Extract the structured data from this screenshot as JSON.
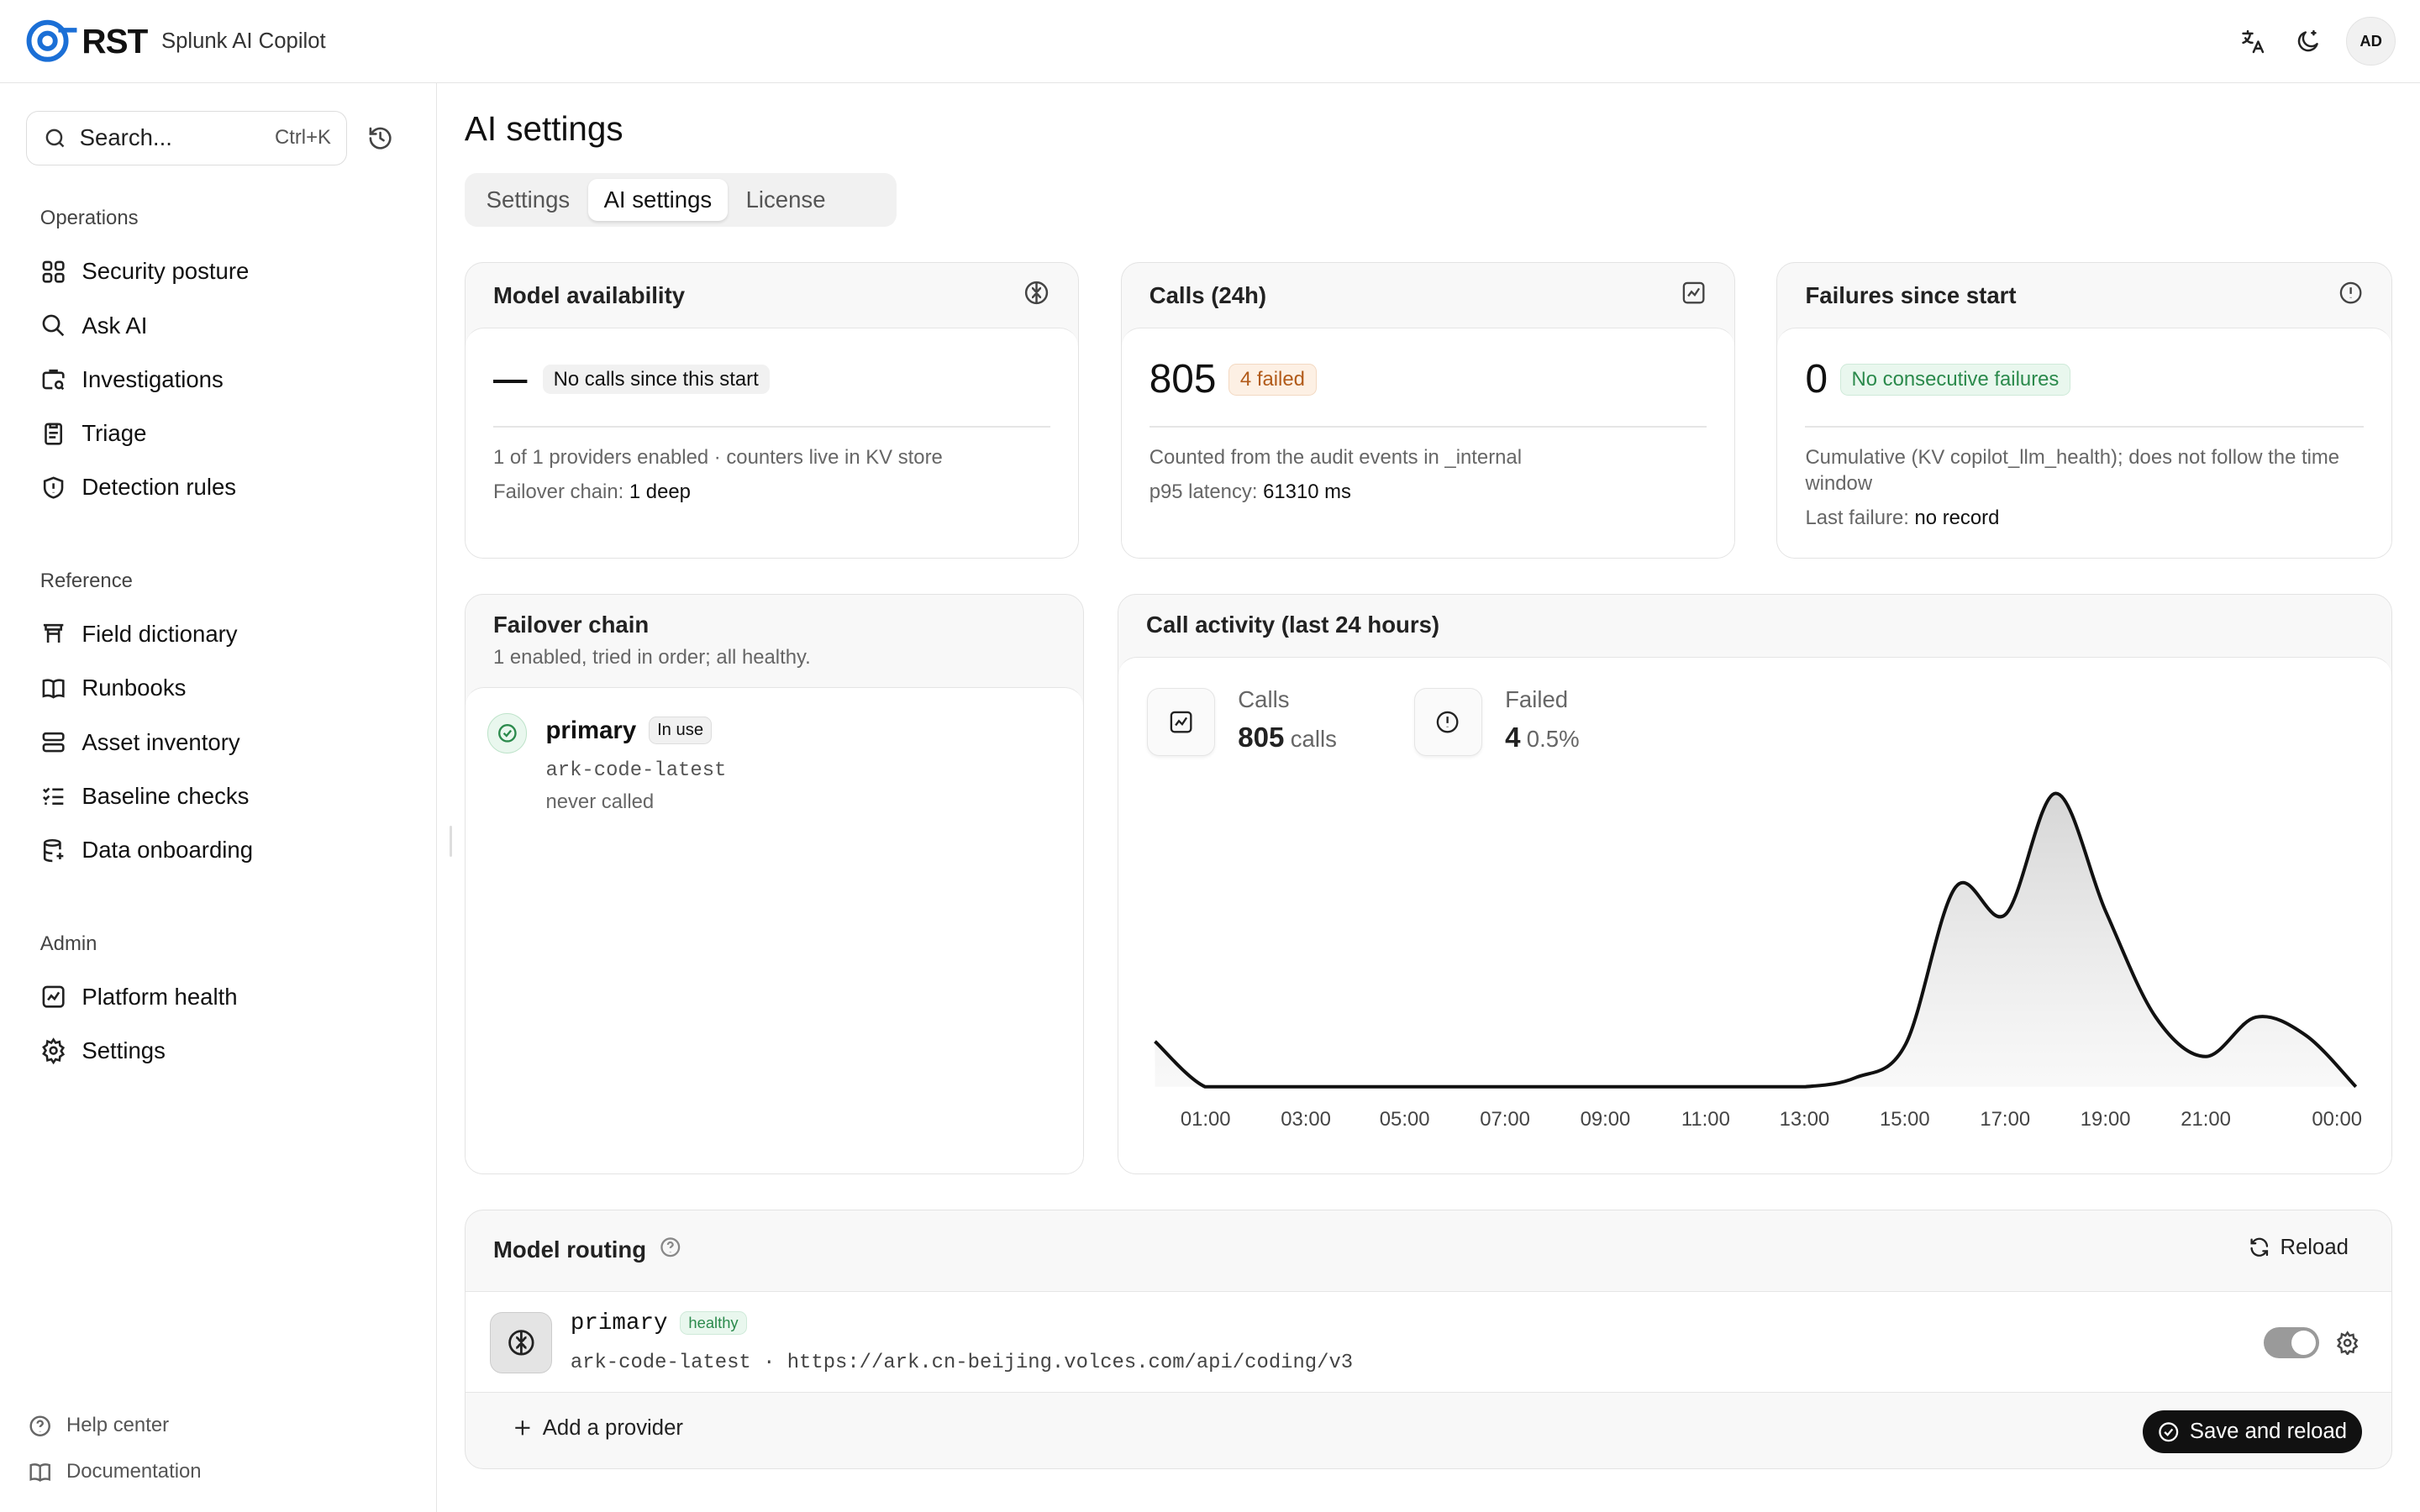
{
  "header": {
    "logo_text": "RST",
    "app_name": "Splunk AI Copilot",
    "avatar": "AD",
    "icons": [
      "translate-icon",
      "theme-toggle-icon"
    ]
  },
  "sidebar": {
    "search_placeholder": "Search...",
    "search_shortcut": "Ctrl+K",
    "sections": [
      {
        "title": "Operations",
        "items": [
          {
            "label": "Security posture",
            "icon": "grid-icon"
          },
          {
            "label": "Ask AI",
            "icon": "search-icon"
          },
          {
            "label": "Investigations",
            "icon": "briefcase-search-icon"
          },
          {
            "label": "Triage",
            "icon": "clipboard-icon"
          },
          {
            "label": "Detection rules",
            "icon": "shield-icon"
          }
        ]
      },
      {
        "title": "Reference",
        "items": [
          {
            "label": "Field dictionary",
            "icon": "table-icon"
          },
          {
            "label": "Runbooks",
            "icon": "book-icon"
          },
          {
            "label": "Asset inventory",
            "icon": "server-icon"
          },
          {
            "label": "Baseline checks",
            "icon": "checklist-icon"
          },
          {
            "label": "Data onboarding",
            "icon": "database-icon"
          }
        ]
      },
      {
        "title": "Admin",
        "items": [
          {
            "label": "Platform health",
            "icon": "chart-icon"
          },
          {
            "label": "Settings",
            "icon": "gear-icon"
          }
        ]
      }
    ],
    "footer": [
      {
        "label": "Help center",
        "icon": "help-icon"
      },
      {
        "label": "Documentation",
        "icon": "book-open-icon"
      }
    ]
  },
  "page": {
    "title": "AI settings",
    "tabs": [
      {
        "label": "Settings",
        "active": false
      },
      {
        "label": "AI settings",
        "active": true
      },
      {
        "label": "License",
        "active": false
      }
    ]
  },
  "cards": {
    "availability": {
      "title": "Model availability",
      "value": "—",
      "badge": "No calls since this start",
      "line1": "1 of 1 providers enabled · counters live in KV store",
      "line2_label": "Failover chain:",
      "line2_value": "1 deep"
    },
    "calls": {
      "title": "Calls (24h)",
      "value": "805",
      "badge": "4 failed",
      "line1": "Counted from the audit events in _internal",
      "line2_label": "p95 latency:",
      "line2_value": "61310 ms"
    },
    "failures": {
      "title": "Failures since start",
      "value": "0",
      "badge": "No consecutive failures",
      "line1": "Cumulative (KV copilot_llm_health); does not follow the time window",
      "line2_label": "Last failure:",
      "line2_value": "no record"
    }
  },
  "failover": {
    "title": "Failover chain",
    "subtitle": "1 enabled, tried in order; all healthy.",
    "provider_name": "primary",
    "provider_badge": "In use",
    "model": "ark-code-latest",
    "status": "never called"
  },
  "activity": {
    "title": "Call activity (last 24 hours)",
    "calls_label": "Calls",
    "calls_value": "805",
    "calls_unit": "calls",
    "failed_label": "Failed",
    "failed_value": "4",
    "failed_pct": "0.5%"
  },
  "chart_data": {
    "type": "area",
    "x": [
      "00:00",
      "01:00",
      "02:00",
      "03:00",
      "04:00",
      "05:00",
      "06:00",
      "07:00",
      "08:00",
      "09:00",
      "10:00",
      "11:00",
      "12:00",
      "13:00",
      "14:00",
      "15:00",
      "16:00",
      "17:00",
      "18:00",
      "19:00",
      "20:00",
      "21:00",
      "22:00",
      "23:00",
      "00:00"
    ],
    "xticks": [
      "01:00",
      "03:00",
      "05:00",
      "07:00",
      "09:00",
      "11:00",
      "13:00",
      "15:00",
      "17:00",
      "19:00",
      "21:00",
      "00:00"
    ],
    "values": [
      15,
      0,
      0,
      0,
      0,
      0,
      0,
      0,
      0,
      0,
      0,
      0,
      0,
      0,
      3,
      14,
      66,
      57,
      97,
      58,
      23,
      10,
      23,
      17,
      0
    ],
    "ylim": [
      0,
      100
    ],
    "grid": false,
    "color": "#111111"
  },
  "routing": {
    "title": "Model routing",
    "reload_label": "Reload",
    "provider_name": "primary",
    "provider_badge": "healthy",
    "provider_detail": "ark-code-latest · https://ark.cn-beijing.volces.com/api/coding/v3",
    "enabled": true,
    "add_label": "Add a provider",
    "save_label": "Save and reload"
  }
}
